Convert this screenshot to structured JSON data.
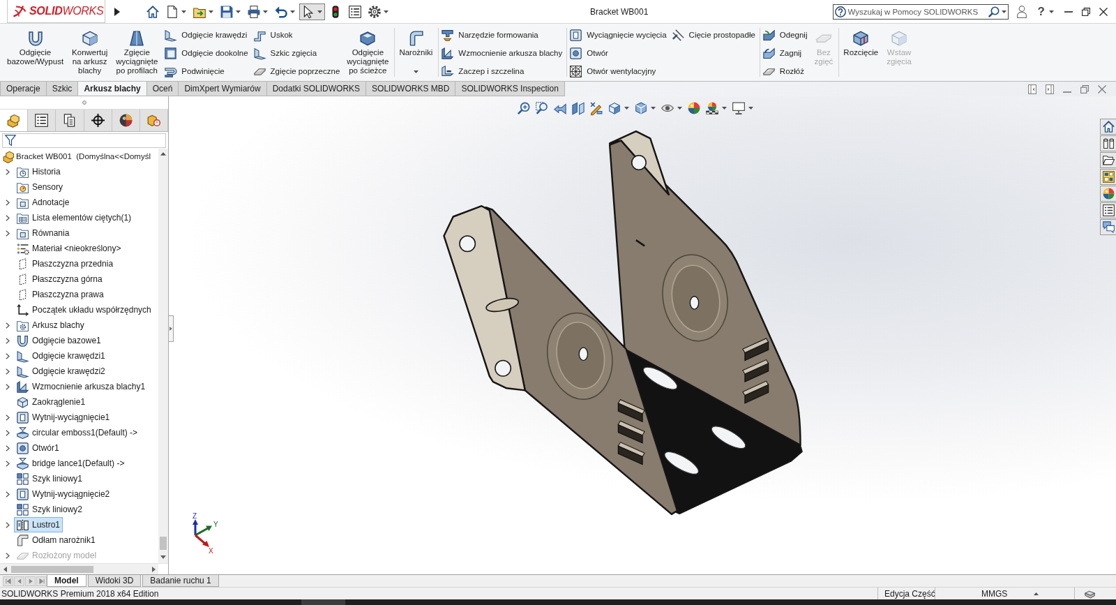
{
  "app_logo": "**SOLID**WORKS",
  "quick_access_toolbar": [
    {
      "dropdown": false,
      "selected": false
    },
    {
      "dropdown": true,
      "selected": false
    },
    {
      "dropdown": true,
      "selected": false
    },
    {
      "dropdown": true,
      "selected": false
    },
    {
      "dropdown": true,
      "selected": false
    },
    {
      "dropdown": true,
      "selected": false
    },
    {
      "dropdown": true,
      "selected": true
    },
    {
      "dropdown": false,
      "selected": false
    },
    {
      "dropdown": false,
      "selected": false
    },
    {
      "dropdown": true,
      "selected": false
    }
  ],
  "window": {
    "title": "Bracket WB001"
  },
  "search": {
    "placeholder": "Wyszukaj w Pomocy SOLIDWORKS"
  },
  "help_button": "?",
  "ribbon": {
    "groups": [
      {
        "blocks": [
          {
            "kind": "large",
            "label": "Odgięcie\nbazowe/Wypust",
            "disabled": false,
            "dropdown": false
          },
          {
            "kind": "large",
            "label": "Konwertuj\nna arkusz\nblachy",
            "disabled": false,
            "dropdown": false
          },
          {
            "kind": "large",
            "label": "Zgięcie\nwyciągnięte\npo profilach",
            "disabled": false,
            "dropdown": false
          },
          {
            "kind": "stack",
            "items": [
              {
                "label": "Odgięcie krawędzi"
              },
              {
                "label": "Odgięcie dookolne"
              },
              {
                "label": "Podwinięcie"
              }
            ]
          },
          {
            "kind": "stack",
            "items": [
              {
                "label": "Uskok"
              },
              {
                "label": "Szkic zgięcia"
              },
              {
                "label": "Zgięcie poprzeczne"
              }
            ]
          },
          {
            "kind": "large",
            "label": "Odgięcie\nwyciągnięte\npo ścieżce",
            "disabled": false,
            "dropdown": false
          }
        ]
      },
      {
        "blocks": [
          {
            "kind": "large",
            "label": "Narożniki",
            "disabled": false,
            "dropdown": true
          }
        ]
      },
      {
        "blocks": [
          {
            "kind": "stack",
            "items": [
              {
                "label": "Narzędzie formowania"
              },
              {
                "label": "Wzmocnienie arkusza blachy"
              },
              {
                "label": "Zaczep i szczelina"
              }
            ]
          }
        ]
      },
      {
        "blocks": [
          {
            "kind": "stack",
            "items": [
              {
                "label": "Wyciągnięcie wycięcia"
              },
              {
                "label": "Otwór"
              },
              {
                "label": "Otwór wentylacyjny"
              }
            ]
          },
          {
            "kind": "stack",
            "items": [
              {
                "label": "Cięcie prostopadłe"
              }
            ]
          }
        ]
      },
      {
        "blocks": [
          {
            "kind": "stack",
            "items": [
              {
                "label": "Odegnij"
              },
              {
                "label": "Zagnij"
              },
              {
                "label": "Rozłóż"
              }
            ]
          },
          {
            "kind": "large",
            "label": "Bez\nzgięć",
            "disabled": true,
            "dropdown": false
          }
        ]
      },
      {
        "blocks": [
          {
            "kind": "large",
            "label": "Rozcięcie",
            "disabled": false,
            "dropdown": false
          },
          {
            "kind": "large",
            "label": "Wstaw\nzgięcia",
            "disabled": true,
            "dropdown": false
          }
        ]
      }
    ]
  },
  "command_tabs": [
    {
      "label": "Operacje",
      "selected": false
    },
    {
      "label": "Szkic",
      "selected": false
    },
    {
      "label": "Arkusz blachy",
      "selected": true
    },
    {
      "label": "Oceń",
      "selected": false
    },
    {
      "label": "DimXpert Wymiarów",
      "selected": false
    },
    {
      "label": "Dodatki SOLIDWORKS",
      "selected": false
    },
    {
      "label": "SOLIDWORKS MBD",
      "selected": false
    },
    {
      "label": "SOLIDWORKS Inspection",
      "selected": false
    }
  ],
  "feature_manager": {
    "panel_tabs": [
      {
        "selected": true
      },
      {
        "selected": false
      },
      {
        "selected": false
      },
      {
        "selected": false
      },
      {
        "selected": false
      },
      {
        "selected": false
      }
    ],
    "tree": {
      "label": "Bracket WB001  (Domyślna<<Domyśl",
      "children": [
        {
          "label": "Historia",
          "expandable": true,
          "selected": false,
          "disabled": false
        },
        {
          "label": "Sensory",
          "expandable": false,
          "selected": false,
          "disabled": false
        },
        {
          "label": "Adnotacje",
          "expandable": true,
          "selected": false,
          "disabled": false
        },
        {
          "label": "Lista elementów ciętych(1)",
          "expandable": true,
          "selected": false,
          "disabled": false
        },
        {
          "label": "Równania",
          "expandable": true,
          "selected": false,
          "disabled": false
        },
        {
          "label": "Materiał <nieokreślony>",
          "expandable": false,
          "selected": false,
          "disabled": false
        },
        {
          "label": "Płaszczyzna przednia",
          "expandable": false,
          "selected": false,
          "disabled": false
        },
        {
          "label": "Płaszczyzna górna",
          "expandable": false,
          "selected": false,
          "disabled": false
        },
        {
          "label": "Płaszczyzna prawa",
          "expandable": false,
          "selected": false,
          "disabled": false
        },
        {
          "label": "Początek układu współrzędnych",
          "expandable": false,
          "selected": false,
          "disabled": false
        },
        {
          "label": "Arkusz blachy",
          "expandable": true,
          "selected": false,
          "disabled": false
        },
        {
          "label": "Odgięcie bazowe1",
          "expandable": true,
          "selected": false,
          "disabled": false
        },
        {
          "label": "Odgięcie krawędzi1",
          "expandable": true,
          "selected": false,
          "disabled": false
        },
        {
          "label": "Odgięcie krawędzi2",
          "expandable": true,
          "selected": false,
          "disabled": false
        },
        {
          "label": "Wzmocnienie arkusza blachy1",
          "expandable": true,
          "selected": false,
          "disabled": false
        },
        {
          "label": "Zaokrąglenie1",
          "expandable": false,
          "selected": false,
          "disabled": false
        },
        {
          "label": "Wytnij-wyciągnięcie1",
          "expandable": true,
          "selected": false,
          "disabled": false
        },
        {
          "label": "circular emboss1(Default) ->",
          "expandable": true,
          "selected": false,
          "disabled": false
        },
        {
          "label": "Otwór1",
          "expandable": true,
          "selected": false,
          "disabled": false
        },
        {
          "label": "bridge lance1(Default) ->",
          "expandable": true,
          "selected": false,
          "disabled": false
        },
        {
          "label": "Szyk liniowy1",
          "expandable": false,
          "selected": false,
          "disabled": false
        },
        {
          "label": "Wytnij-wyciągnięcie2",
          "expandable": true,
          "selected": false,
          "disabled": false
        },
        {
          "label": "Szyk liniowy2",
          "expandable": false,
          "selected": false,
          "disabled": false
        },
        {
          "label": "Lustro1",
          "expandable": true,
          "selected": true,
          "disabled": false
        },
        {
          "label": "Odłam narożnik1",
          "expandable": false,
          "selected": false,
          "disabled": false
        },
        {
          "label": "Rozłożony model",
          "expandable": true,
          "selected": false,
          "disabled": true
        }
      ]
    }
  },
  "viewport": {
    "triad": {
      "z_label": "Z",
      "y_label": "Y",
      "x_label": "X"
    }
  },
  "bottom_tabs": [
    {
      "label": "Model",
      "selected": true
    },
    {
      "label": "Widoki 3D",
      "selected": false
    },
    {
      "label": "Badanie ruchu 1",
      "selected": false
    }
  ],
  "status_bar": {
    "edition": "SOLIDWORKS Premium 2018 x64 Edition",
    "mode": "Edycja Część",
    "units": "MMGS"
  }
}
